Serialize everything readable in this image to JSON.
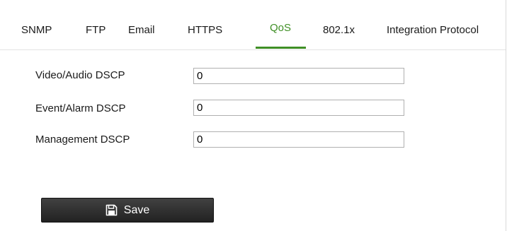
{
  "tabs": [
    {
      "label": "SNMP",
      "active": false
    },
    {
      "label": "FTP",
      "active": false
    },
    {
      "label": "Email",
      "active": false
    },
    {
      "label": "HTTPS",
      "active": false
    },
    {
      "label": "QoS",
      "active": true
    },
    {
      "label": "802.1x",
      "active": false
    },
    {
      "label": "Integration Protocol",
      "active": false
    }
  ],
  "form": {
    "fields": [
      {
        "label": "Video/Audio DSCP",
        "value": "0"
      },
      {
        "label": "Event/Alarm DSCP",
        "value": "0"
      },
      {
        "label": "Management DSCP",
        "value": "0"
      }
    ],
    "save_label": "Save",
    "save_icon": "save-icon"
  },
  "colors": {
    "active_tab": "#3f8f25",
    "button_bg": "#2b2b2b",
    "button_text": "#ffffff"
  }
}
